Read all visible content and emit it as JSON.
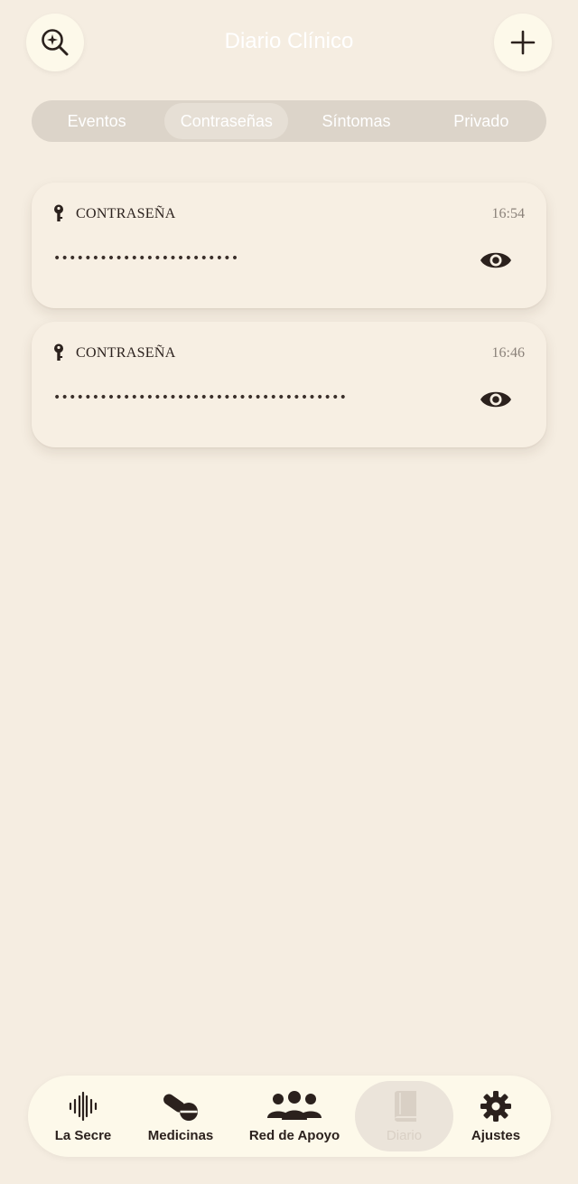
{
  "header": {
    "title": "Diario Clínico",
    "left_icon": "magnify-sparkle-icon",
    "right_icon": "plus-icon"
  },
  "tabs": [
    {
      "label": "Eventos",
      "active": false
    },
    {
      "label": "Contraseñas",
      "active": true
    },
    {
      "label": "Síntomas",
      "active": false
    },
    {
      "label": "Privado",
      "active": false
    }
  ],
  "entries": [
    {
      "type_label": "CONTRASEÑA",
      "time": "16:54",
      "masked": "••••••••••••••••••••••••",
      "icon": "key-icon",
      "action_icon": "eye-icon"
    },
    {
      "type_label": "CONTRASEÑA",
      "time": "16:46",
      "masked": "••••••••••••••••••••••••••••••••••••••",
      "icon": "key-icon",
      "action_icon": "eye-icon"
    }
  ],
  "nav": [
    {
      "label": "La Secre",
      "icon": "waveform-icon",
      "active": false
    },
    {
      "label": "Medicinas",
      "icon": "pills-icon",
      "active": false
    },
    {
      "label": "Red de Apoyo",
      "icon": "people-icon",
      "active": false
    },
    {
      "label": "Diario",
      "icon": "book-icon",
      "active": true
    },
    {
      "label": "Ajustes",
      "icon": "gear-icon",
      "active": false
    }
  ],
  "colors": {
    "background": "#f5ede1",
    "card": "#f7efe3",
    "nav": "#fdf9ea",
    "text": "#2b211d",
    "muted": "#8b827a"
  }
}
